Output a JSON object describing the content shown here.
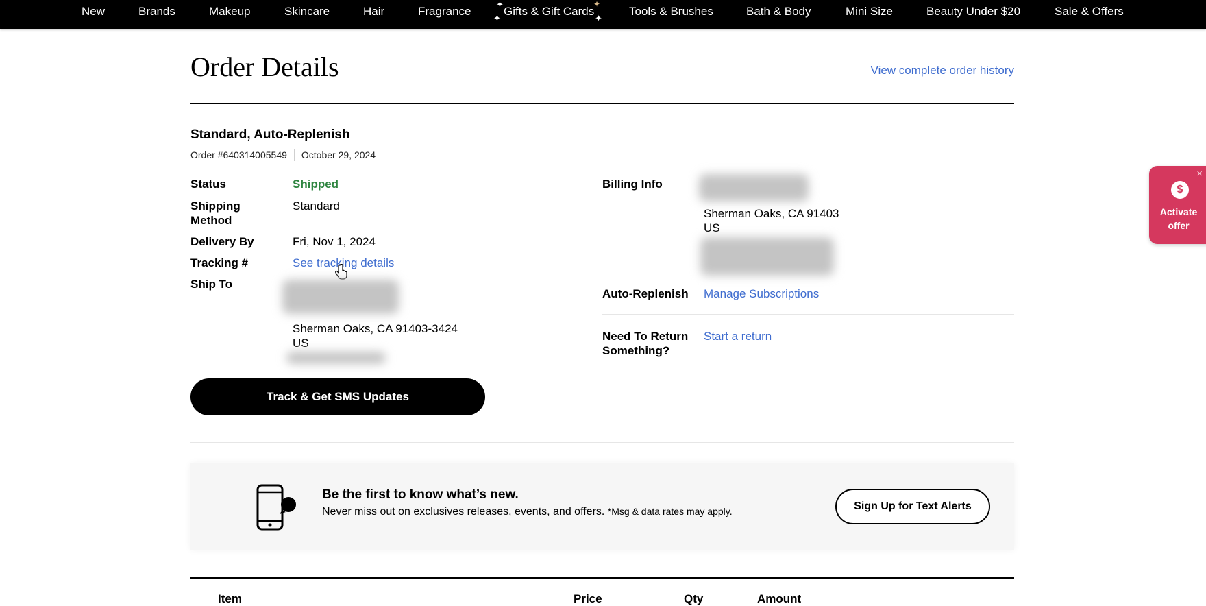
{
  "nav": {
    "items": [
      "New",
      "Brands",
      "Makeup",
      "Skincare",
      "Hair",
      "Fragrance",
      "Gifts & Gift Cards",
      "Tools & Brushes",
      "Bath & Body",
      "Mini Size",
      "Beauty Under $20",
      "Sale & Offers"
    ]
  },
  "header": {
    "title": "Order Details",
    "history_link": "View complete order history"
  },
  "order": {
    "type": "Standard, Auto-Replenish",
    "number": "Order #640314005549",
    "date": "October 29, 2024",
    "status_label": "Status",
    "status_value": "Shipped",
    "shipping_method_label": "Shipping Method",
    "shipping_method_value": "Standard",
    "delivery_label": "Delivery By",
    "delivery_value": "Fri, Nov 1, 2024",
    "tracking_label": "Tracking #",
    "tracking_link": "See tracking details",
    "ship_to_label": "Ship To",
    "ship_to_city": "Sherman Oaks, CA 91403-3424",
    "ship_to_country": "US",
    "sms_button": "Track & Get SMS Updates"
  },
  "billing": {
    "label": "Billing Info",
    "city": "Sherman Oaks, CA 91403",
    "country": "US"
  },
  "auto_replenish": {
    "label": "Auto-Replenish",
    "link": "Manage Subscriptions"
  },
  "returns": {
    "label": "Need To Return Something?",
    "link": "Start a return"
  },
  "offer": {
    "coin_symbol": "$",
    "close_symbol": "×",
    "label": "Activate offer"
  },
  "promo": {
    "title": "Be the first to know what’s new.",
    "subtitle": "Never miss out on exclusives releases, events, and offers.",
    "note": "*Msg & data rates may apply.",
    "button": "Sign Up for Text Alerts"
  },
  "items_table": {
    "headers": [
      "Item",
      "Price",
      "Qty",
      "Amount"
    ]
  },
  "colors": {
    "link": "#3e6ccf",
    "status_shipped": "#2e8540",
    "offer": "#d5385e",
    "nav_bg": "#000000"
  }
}
